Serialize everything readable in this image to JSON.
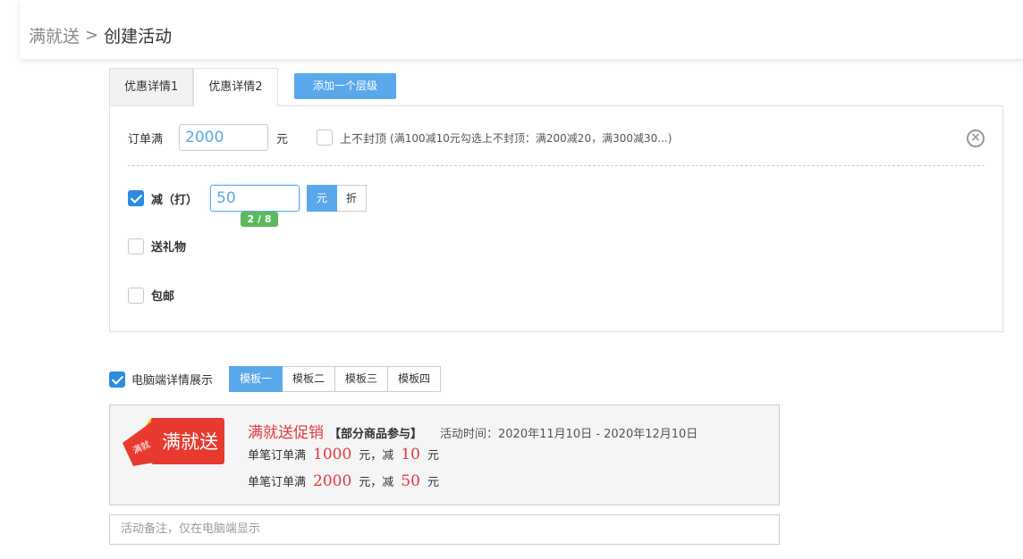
{
  "breadcrumb": {
    "parent": "满就送",
    "separator": ">",
    "current": "创建活动"
  },
  "tabs": [
    {
      "label": "优惠详情1"
    },
    {
      "label": "优惠详情2"
    }
  ],
  "add_tier_button": "添加一个层级",
  "tier": {
    "order_label": "订单满",
    "order_value": "2000",
    "order_unit": "元",
    "no_cap_label": "上不封顶",
    "no_cap_hint": "(满100减10元勾选上不封顶：满200减20，满300减30...)",
    "discount_label": "减（打）",
    "discount_value": "50",
    "discount_counter": "2 / 8",
    "unit_yuan": "元",
    "unit_zhe": "折",
    "gift_label": "送礼物",
    "free_shipping_label": "包邮"
  },
  "pc_display": {
    "label": "电脑端详情展示",
    "templates": [
      "模板一",
      "模板二",
      "模板三",
      "模板四"
    ]
  },
  "preview": {
    "logo_text_small": "满就",
    "logo_text": "满就送",
    "title": "满就送促销",
    "scope": "【部分商品参与】",
    "time_label": "活动时间：2020年11月10日 - 2020年12月10日",
    "rule_prefix": "单笔订单满",
    "rule_middle": "元，减",
    "rule_suffix": "元",
    "rules": [
      {
        "threshold": "1000",
        "discount": "10"
      },
      {
        "threshold": "2000",
        "discount": "50"
      }
    ]
  },
  "remark_placeholder": "活动备注，仅在电脑端显示",
  "colors": {
    "primary": "#5aa8ec",
    "checkbox": "#2d8cdf",
    "promo_red": "#e4393c",
    "counter_green": "#5cb85c"
  }
}
